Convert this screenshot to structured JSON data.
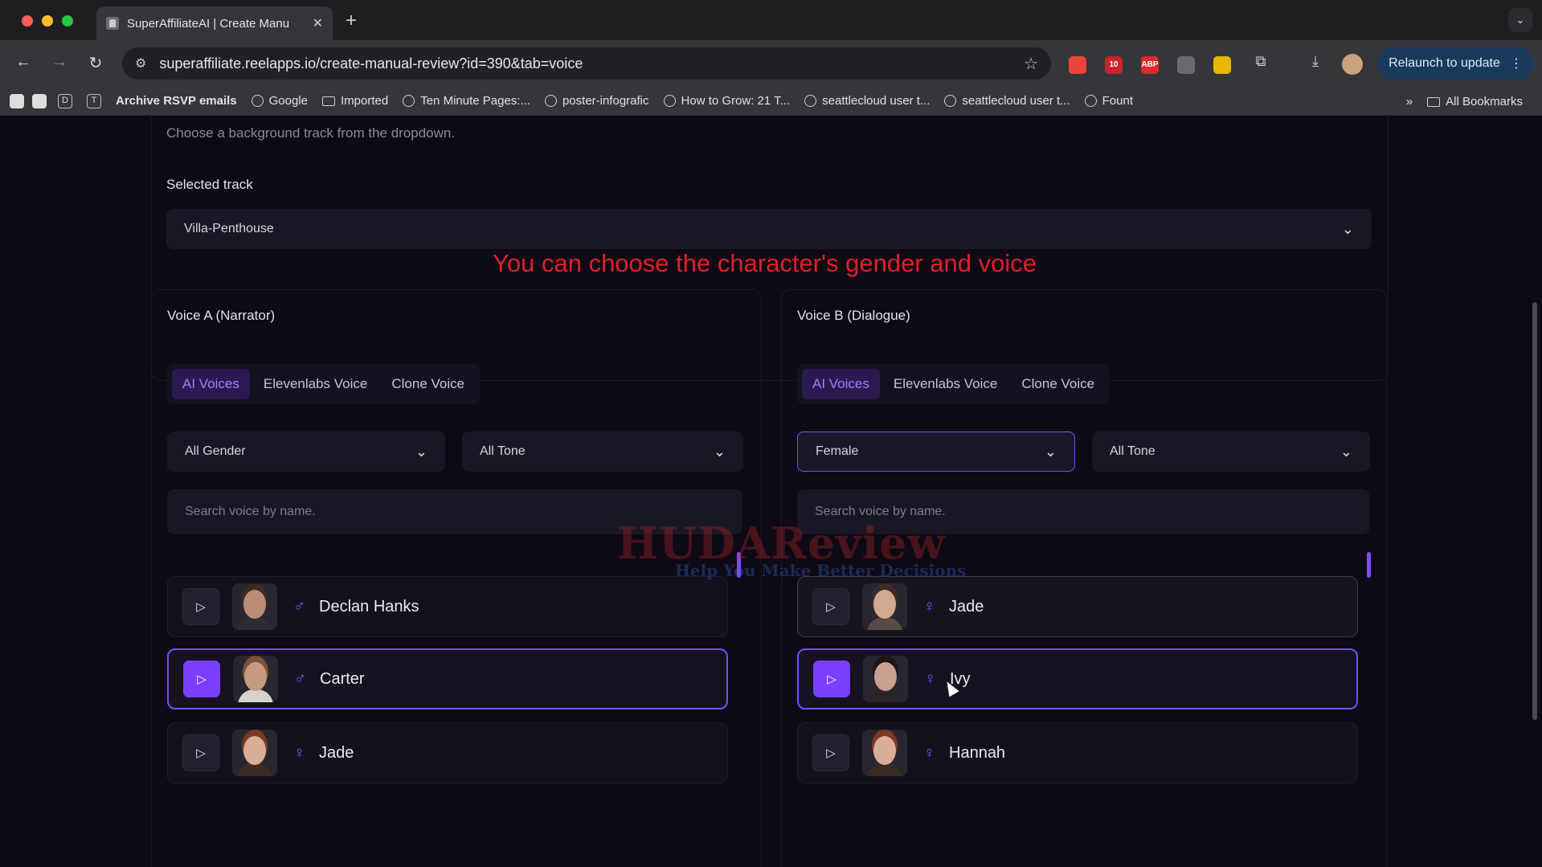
{
  "browser": {
    "tab_title": "SuperAffiliateAI | Create Manu",
    "url": "superaffiliate.reelapps.io/create-manual-review?id=390&tab=voice",
    "relaunch_label": "Relaunch to update",
    "extensions": [
      {
        "name": "ext-red-icon",
        "label": "",
        "color": "#e8463a"
      },
      {
        "name": "ext-calendar-icon",
        "label": "10",
        "color": "#c8232c"
      },
      {
        "name": "adblock-icon",
        "label": "ABP",
        "color": "#d92b2b"
      },
      {
        "name": "ext-gray-icon",
        "label": "",
        "color": "#6a6a6a"
      },
      {
        "name": "ext-color-icon",
        "label": "",
        "color": "#e6b800"
      }
    ],
    "bookmarks": [
      {
        "label": "D",
        "type": "box"
      },
      {
        "label": "T",
        "type": "box"
      },
      {
        "label": "Archive RSVP emails",
        "type": "text"
      },
      {
        "label": "Google",
        "type": "globe"
      },
      {
        "label": "Imported",
        "type": "folder"
      },
      {
        "label": "Ten Minute Pages:...",
        "type": "globe"
      },
      {
        "label": "poster-infografic",
        "type": "globe"
      },
      {
        "label": "How to Grow: 21 T...",
        "type": "globe"
      },
      {
        "label": "seattlecloud user t...",
        "type": "globe"
      },
      {
        "label": "seattlecloud user t...",
        "type": "globe"
      },
      {
        "label": "Fount",
        "type": "globe"
      }
    ],
    "all_bookmarks": "All Bookmarks"
  },
  "page": {
    "hint": "Choose a background track from the dropdown.",
    "selected_track_label": "Selected track",
    "selected_track_value": "Villa-Penthouse",
    "annotation": "You can choose the character's gender and voice",
    "watermark": "HUDAReview",
    "watermark_sub": "Help You Make Better Decisions"
  },
  "voice_a": {
    "title": "Voice A (Narrator)",
    "tabs": [
      "AI Voices",
      "Elevenlabs Voice",
      "Clone Voice"
    ],
    "gender_filter": "All Gender",
    "tone_filter": "All Tone",
    "search_placeholder": "Search voice by name.",
    "voices": [
      {
        "name": "Declan Hanks",
        "gender": "male",
        "state": "normal"
      },
      {
        "name": "Carter",
        "gender": "male",
        "state": "selected"
      },
      {
        "name": "Jade",
        "gender": "female",
        "state": "normal"
      }
    ]
  },
  "voice_b": {
    "title": "Voice B (Dialogue)",
    "tabs": [
      "AI Voices",
      "Elevenlabs Voice",
      "Clone Voice"
    ],
    "gender_filter": "Female",
    "tone_filter": "All Tone",
    "search_placeholder": "Search voice by name.",
    "voices": [
      {
        "name": "Jade",
        "gender": "female",
        "state": "hovered"
      },
      {
        "name": "Ivy",
        "gender": "female",
        "state": "selected"
      },
      {
        "name": "Hannah",
        "gender": "female",
        "state": "normal"
      }
    ]
  },
  "colors": {
    "accent": "#7b4dff",
    "annotation": "#e0202a",
    "background": "#0d0a16"
  }
}
